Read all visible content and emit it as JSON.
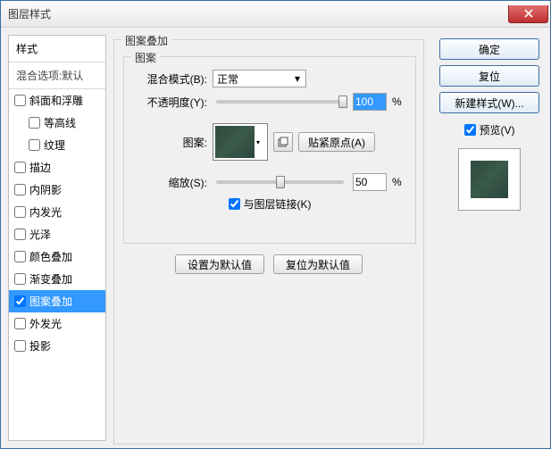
{
  "window": {
    "title": "图层样式"
  },
  "sidebar": {
    "header": "样式",
    "subheader": "混合选项:默认",
    "items": [
      {
        "label": "斜面和浮雕",
        "checked": false,
        "indent": false
      },
      {
        "label": "等高线",
        "checked": false,
        "indent": true
      },
      {
        "label": "纹理",
        "checked": false,
        "indent": true
      },
      {
        "label": "描边",
        "checked": false,
        "indent": false
      },
      {
        "label": "内阴影",
        "checked": false,
        "indent": false
      },
      {
        "label": "内发光",
        "checked": false,
        "indent": false
      },
      {
        "label": "光泽",
        "checked": false,
        "indent": false
      },
      {
        "label": "颜色叠加",
        "checked": false,
        "indent": false
      },
      {
        "label": "渐变叠加",
        "checked": false,
        "indent": false
      },
      {
        "label": "图案叠加",
        "checked": true,
        "indent": false,
        "active": true
      },
      {
        "label": "外发光",
        "checked": false,
        "indent": false
      },
      {
        "label": "投影",
        "checked": false,
        "indent": false
      }
    ]
  },
  "main": {
    "group_title": "图案叠加",
    "pattern_group": "图案",
    "blend_label": "混合模式(B):",
    "blend_value": "正常",
    "opacity_label": "不透明度(Y):",
    "opacity_value": "100",
    "percent": "%",
    "pattern_label": "图案:",
    "snap_btn": "贴紧原点(A)",
    "scale_label": "缩放(S):",
    "scale_value": "50",
    "link_label": "与图层链接(K)",
    "set_default": "设置为默认值",
    "reset_default": "复位为默认值"
  },
  "right": {
    "ok": "确定",
    "cancel": "复位",
    "new_style": "新建样式(W)...",
    "preview": "预览(V)"
  }
}
